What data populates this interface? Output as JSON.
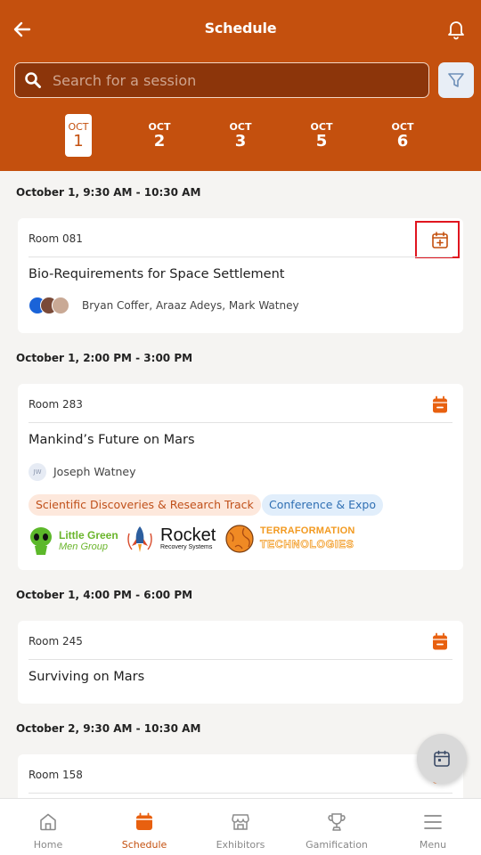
{
  "app": {
    "title": "Schedule",
    "accent": "#c4500e"
  },
  "search": {
    "placeholder": "Search for a session",
    "value": ""
  },
  "dates": [
    {
      "month": "OCT",
      "day": "1",
      "active": true
    },
    {
      "month": "OCT",
      "day": "2",
      "active": false
    },
    {
      "month": "OCT",
      "day": "3",
      "active": false
    },
    {
      "month": "OCT",
      "day": "5",
      "active": false
    },
    {
      "month": "OCT",
      "day": "6",
      "active": false
    }
  ],
  "sessions": [
    {
      "time": "October 1, 9:30 AM - 10:30 AM",
      "room": "Room 081",
      "title": "Bio-Requirements for Space Settlement",
      "speakers": "Bryan Coffer, Araaz Adeys, Mark Watney",
      "calendar_state": "add"
    },
    {
      "time": "October 1, 2:00 PM - 3:00 PM",
      "room": "Room 283",
      "title": "Mankind’s Future on Mars",
      "speaker_initials": "JW",
      "speakers": "Joseph Watney",
      "tags": [
        "Scientific Discoveries & Research Track",
        "Conference & Expo"
      ],
      "sponsors": {
        "lgm_line1": "Little Green",
        "lgm_line2": "Men Group",
        "rocket_line1": "Rocket",
        "rocket_line2": "Recovery Systems",
        "terra_line1": "TERRAFORMATION",
        "terra_line2": "TECHNOLOGIES"
      },
      "calendar_state": "added"
    },
    {
      "time": "October 1, 4:00 PM - 6:00 PM",
      "room": "Room 245",
      "title": "Surviving on Mars",
      "calendar_state": "added"
    },
    {
      "time": "October 2, 9:30 AM - 10:30 AM",
      "room": "Room 158",
      "calendar_state": "added"
    }
  ],
  "nav": [
    {
      "label": "Home",
      "icon": "home-icon"
    },
    {
      "label": "Schedule",
      "icon": "calendar-icon",
      "active": true
    },
    {
      "label": "Exhibitors",
      "icon": "store-icon"
    },
    {
      "label": "Gamification",
      "icon": "trophy-icon"
    },
    {
      "label": "Menu",
      "icon": "menu-icon"
    }
  ]
}
